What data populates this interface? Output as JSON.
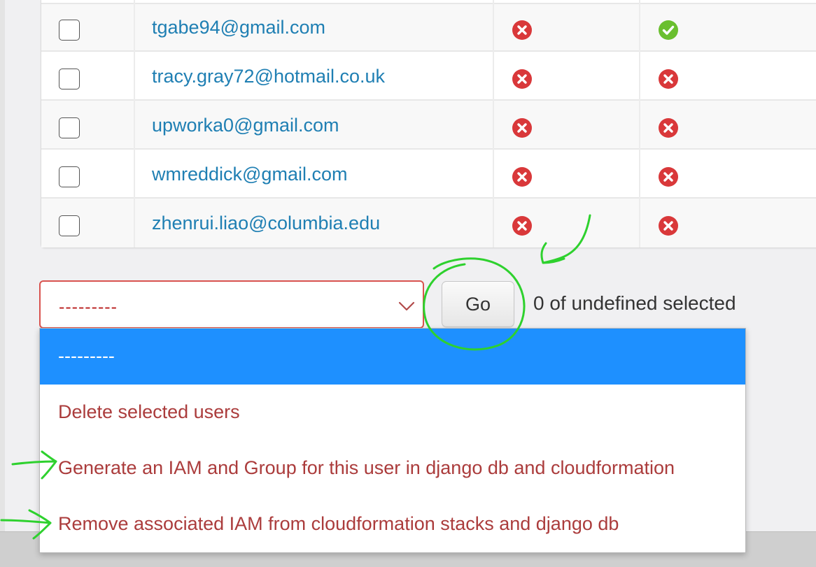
{
  "users_table": {
    "rows": [
      {
        "email": "tgabe94@gmail.com",
        "status_1": "error-icon",
        "status_2": "success-icon"
      },
      {
        "email": "tracy.gray72@hotmail.co.uk",
        "status_1": "error-icon",
        "status_2": "error-icon"
      },
      {
        "email": "upworka0@gmail.com",
        "status_1": "error-icon",
        "status_2": "error-icon"
      },
      {
        "email": "wmreddick@gmail.com",
        "status_1": "error-icon",
        "status_2": "error-icon"
      },
      {
        "email": "zhenrui.liao@columbia.edu",
        "status_1": "error-icon",
        "status_2": "error-icon"
      }
    ]
  },
  "actions": {
    "select_value": "---------",
    "go_label": "Go",
    "selection_counter": "0 of undefined selected",
    "options": [
      "---------",
      "Delete selected users",
      "Generate an IAM and Group for this user in django db and cloudformation",
      "Remove associated IAM from cloudformation stacks and django db"
    ]
  },
  "colors": {
    "link": "#1f7fb3",
    "error": "#d9383a",
    "success": "#6abf2f",
    "option_text": "#ab3c3c",
    "option_highlight": "#1e90ff",
    "annotation": "#2ed12e"
  }
}
